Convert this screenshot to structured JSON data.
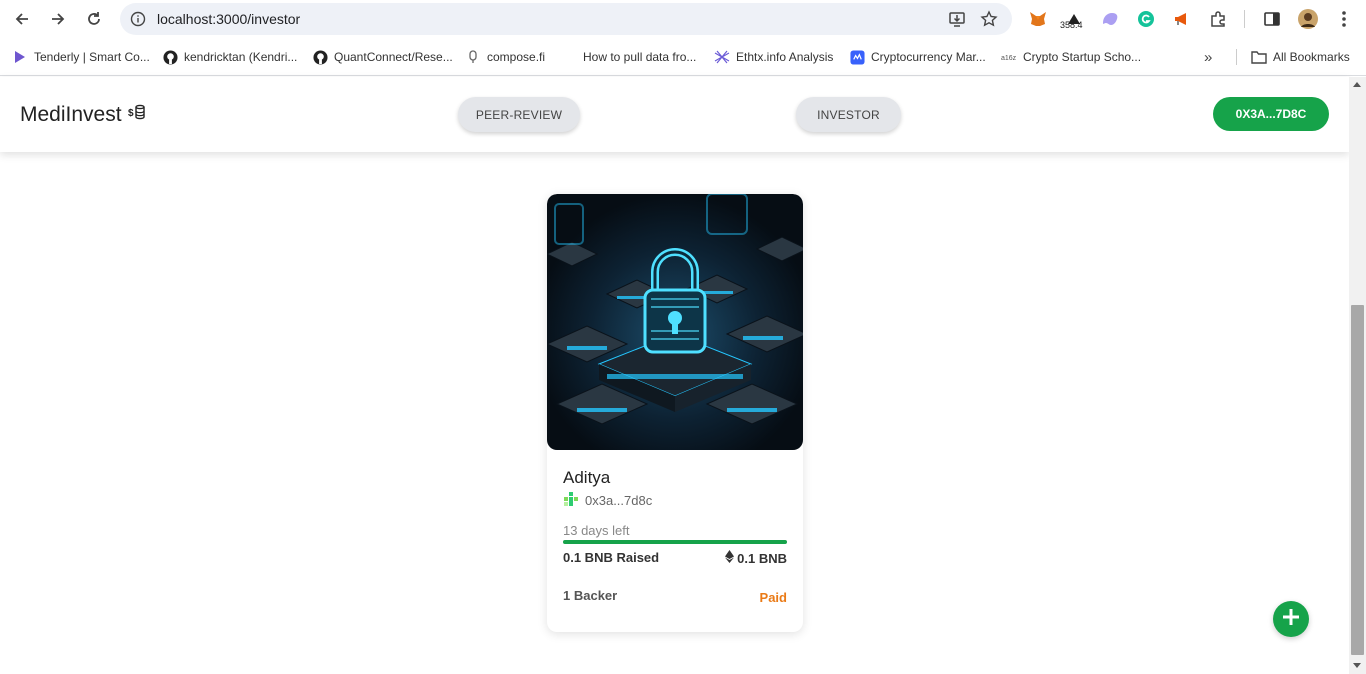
{
  "browser": {
    "url": "localhost:3000/investor",
    "extension_badge": "358.4",
    "bookmarks": [
      {
        "label": "Tenderly | Smart Co...",
        "icon": "tenderly-icon"
      },
      {
        "label": "kendricktan (Kendri...",
        "icon": "github-icon"
      },
      {
        "label": "QuantConnect/Rese...",
        "icon": "github-icon"
      },
      {
        "label": "compose.fi",
        "icon": "compose-icon"
      },
      {
        "label": "How to pull data fro...",
        "icon": ""
      },
      {
        "label": "Ethtx.info Analysis",
        "icon": "ethtx-icon"
      },
      {
        "label": "Cryptocurrency Mar...",
        "icon": "coinmarketcap-icon"
      },
      {
        "label": "Crypto Startup Scho...",
        "icon": "a16z-icon"
      }
    ],
    "all_bookmarks": "All Bookmarks",
    "more_bookmarks": "»"
  },
  "app": {
    "brand": "MediInvest",
    "brand_icon": "money-stack-icon",
    "nav": {
      "peer_review": "PEER-REVIEW",
      "investor": "INVESTOR"
    },
    "wallet_label": "0X3A...7D8C",
    "accent_color": "#16a34a"
  },
  "campaign": {
    "owner_name": "Aditya",
    "owner_address": "0x3a...7d8c",
    "days_left": "13 days left",
    "progress_fraction": 1.0,
    "raised": "0.1 BNB Raised",
    "target": "0.1 BNB",
    "backers": "1 Backer",
    "status": "Paid",
    "status_color": "#ea7a16"
  }
}
